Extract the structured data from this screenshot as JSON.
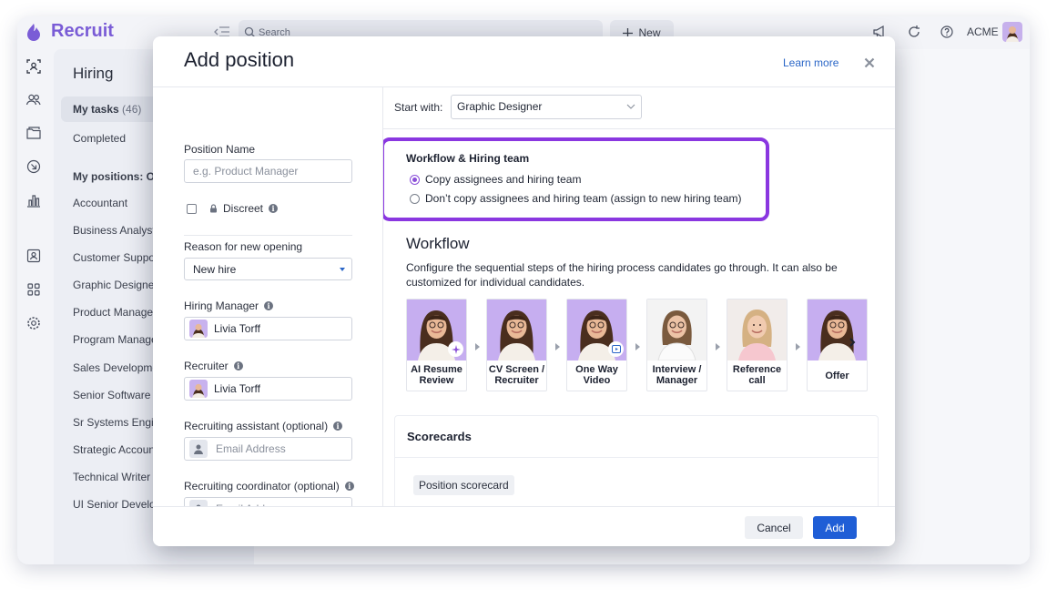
{
  "app": {
    "brand": "Recruit",
    "company": "ACME",
    "search_placeholder": "Search",
    "new_label": "New"
  },
  "colors": {
    "brand": "#7a5cd6",
    "accent": "#1f5ed6",
    "highlight": "#8a37e0",
    "link": "#2a66c7"
  },
  "icons": {
    "rail": [
      "candidate-search-icon",
      "people-icon",
      "folder-icon",
      "arrow-circle-icon",
      "chart-icon",
      "contact-card-icon",
      "grid-icon",
      "settings-icon"
    ],
    "topbar": [
      "megaphone-icon",
      "refresh-icon",
      "help-icon"
    ]
  },
  "sidebar": {
    "title": "Hiring",
    "my_tasks": "My tasks",
    "my_tasks_count": "(46)",
    "completed": "Completed",
    "positions_header": "My positions: Op",
    "positions": [
      "Accountant",
      "Business Analyst",
      "Customer Suppo",
      "Graphic Designer",
      "Product Manager",
      "Program Manage",
      "Sales Developme",
      "Senior Software I",
      "Sr Systems Engin",
      "Strategic Accoun",
      "Technical Writer",
      "UI Senior Develop"
    ]
  },
  "modal": {
    "title": "Add position",
    "learn_more": "Learn more",
    "position_name_label": "Position Name",
    "position_name_placeholder": "e.g. Product Manager",
    "discreet_label": "Discreet",
    "reason_label": "Reason for new opening",
    "reason_value": "New hire",
    "hiring_manager_label": "Hiring Manager",
    "hiring_manager_value": "Livia Torff",
    "recruiter_label": "Recruiter",
    "recruiter_value": "Livia Torff",
    "assistant_label": "Recruiting assistant (optional)",
    "assistant_placeholder": "Email Address",
    "coordinator_label": "Recruiting coordinator (optional)",
    "coordinator_placeholder": "Email Address",
    "start_with_label": "Start with:",
    "start_with_value": "Graphic Designer",
    "workflow_team_title": "Workflow & Hiring team",
    "radio_copy": "Copy assignees and hiring team",
    "radio_nocopy": "Don’t copy assignees and hiring team (assign to new hiring team)",
    "radio_selected": "copy",
    "workflow_heading": "Workflow",
    "workflow_desc": "Configure the sequential steps of the hiring process candidates go through. It can also be customized for individual candidates.",
    "steps": [
      {
        "label": "AI Resume Review",
        "line1": "AI Resume",
        "line2": "Review",
        "badge": "sparkle-icon"
      },
      {
        "label": "CV Screen / Recruiter",
        "line1": "CV Screen /",
        "line2": "Recruiter",
        "badge": ""
      },
      {
        "label": "One Way Video",
        "line1": "One Way",
        "line2": "Video",
        "badge": "video-icon"
      },
      {
        "label": "Interview / Manager",
        "line1": "Interview /",
        "line2": "Manager",
        "badge": ""
      },
      {
        "label": "Reference call",
        "line1": "Reference",
        "line2": "call",
        "badge": ""
      },
      {
        "label": "Offer",
        "line1": "Offer",
        "line2": "",
        "badge": ""
      }
    ],
    "scorecards_title": "Scorecards",
    "scorecard_tag": "Position scorecard",
    "cancel": "Cancel",
    "add": "Add"
  }
}
